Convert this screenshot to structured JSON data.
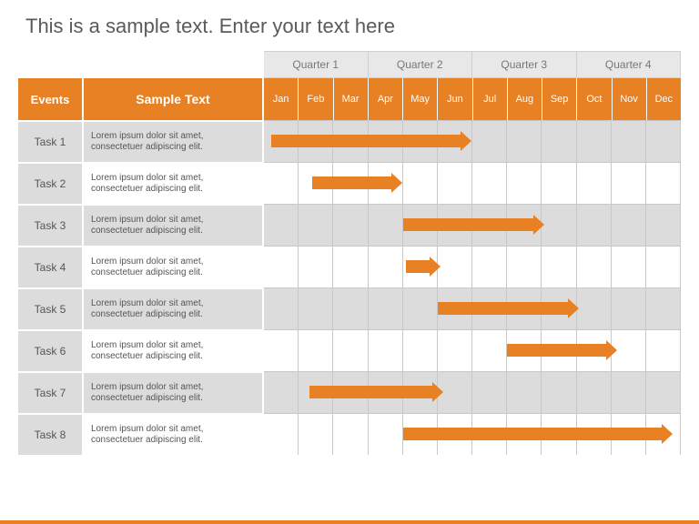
{
  "title": "This is a sample text. Enter your text here",
  "chart_data": {
    "type": "gantt",
    "quarters": [
      "Quarter 1",
      "Quarter 2",
      "Quarter 3",
      "Quarter 4"
    ],
    "months": [
      "Jan",
      "Feb",
      "Mar",
      "Apr",
      "May",
      "Jun",
      "Jul",
      "Aug",
      "Sep",
      "Oct",
      "Nov",
      "Dec"
    ],
    "columns": {
      "events": "Events",
      "desc": "Sample Text"
    },
    "tasks": [
      {
        "name": "Task 1",
        "desc": "Lorem ipsum dolor sit amet, consectetuer adipiscing elit.",
        "start": 0.2,
        "end": 6.0
      },
      {
        "name": "Task 2",
        "desc": "Lorem ipsum dolor sit amet, consectetuer adipiscing elit.",
        "start": 1.4,
        "end": 4.0
      },
      {
        "name": "Task 3",
        "desc": "Lorem ipsum dolor sit amet, consectetuer adipiscing elit.",
        "start": 4.0,
        "end": 8.1
      },
      {
        "name": "Task 4",
        "desc": "Lorem ipsum dolor sit amet, consectetuer adipiscing elit.",
        "start": 4.1,
        "end": 5.1
      },
      {
        "name": "Task 5",
        "desc": "Lorem ipsum dolor sit amet, consectetuer adipiscing elit.",
        "start": 5.0,
        "end": 9.1
      },
      {
        "name": "Task 6",
        "desc": "Lorem ipsum dolor sit amet, consectetuer adipiscing elit.",
        "start": 7.0,
        "end": 10.2
      },
      {
        "name": "Task 7",
        "desc": "Lorem ipsum dolor sit amet, consectetuer adipiscing elit.",
        "start": 1.3,
        "end": 5.2
      },
      {
        "name": "Task 8",
        "desc": "Lorem ipsum dolor sit amet, consectetuer adipiscing elit.",
        "start": 4.0,
        "end": 11.8
      }
    ],
    "xrange": [
      0,
      12
    ]
  },
  "colors": {
    "accent": "#e88024",
    "grid": "#c8c8c8",
    "altRow": "#dcdcdc"
  }
}
